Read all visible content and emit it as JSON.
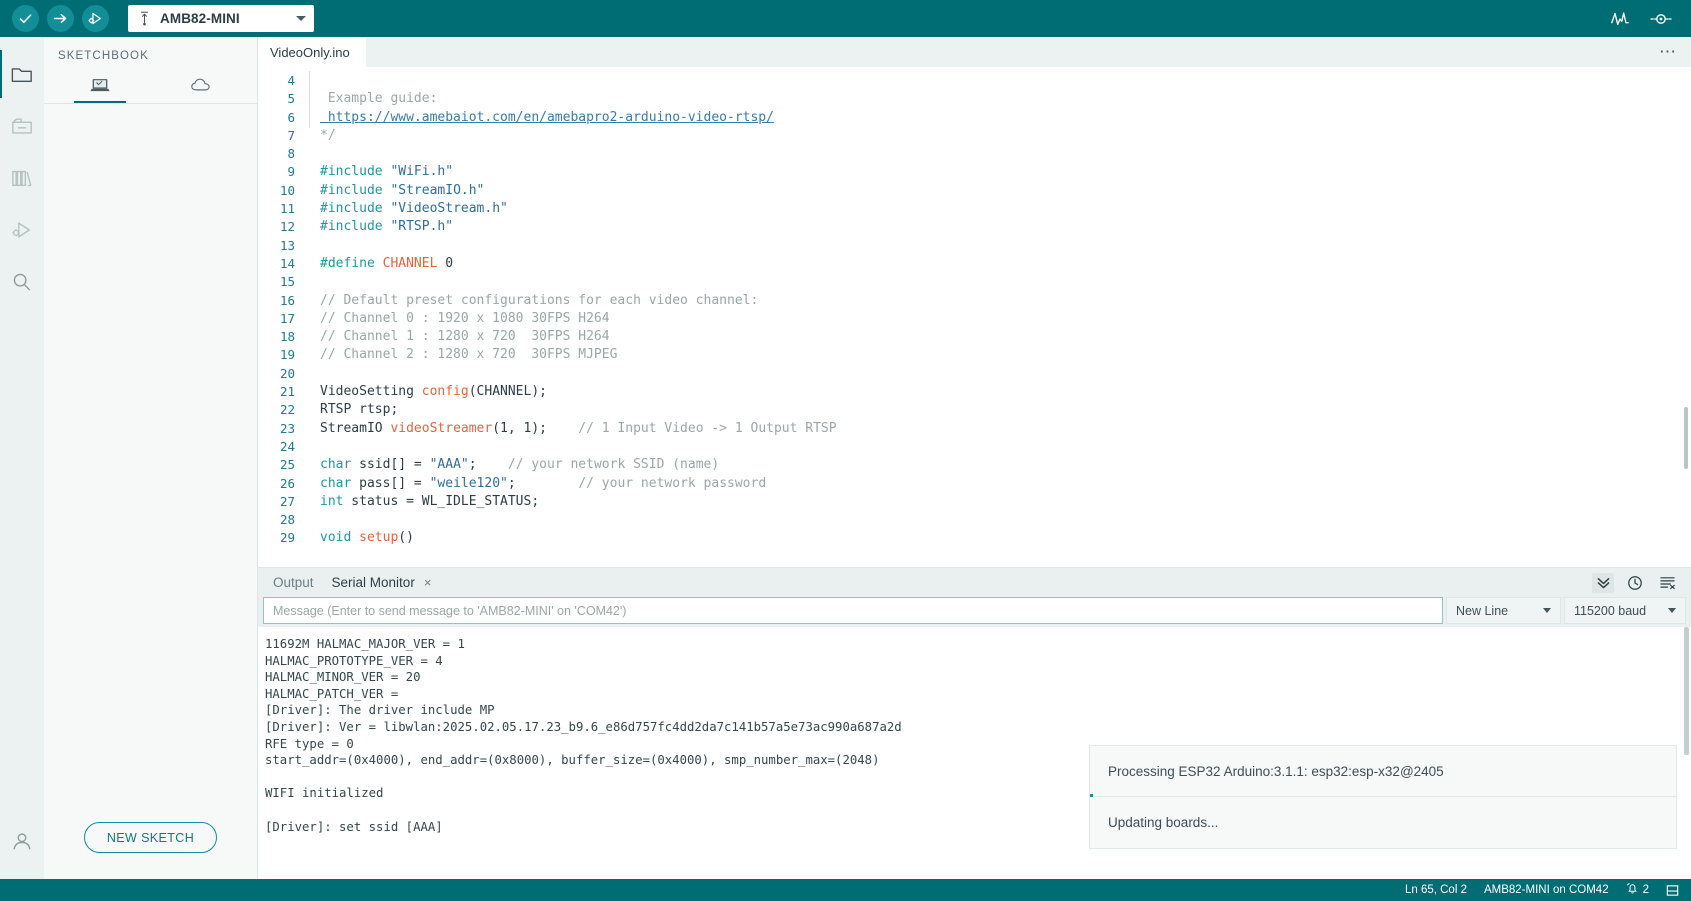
{
  "toolbar": {
    "verify_label": "verify-sketch",
    "upload_label": "upload-sketch",
    "debug_label": "start-debugging",
    "board_name": "AMB82-MINI",
    "serial_plotter_label": "serial-plotter",
    "serial_monitor_label": "serial-monitor"
  },
  "activitybar": {
    "items": [
      {
        "name": "sketchbook",
        "label": "Sketchbook"
      },
      {
        "name": "boards-manager",
        "label": "Boards Manager"
      },
      {
        "name": "library-manager",
        "label": "Library Manager"
      },
      {
        "name": "debug",
        "label": "Debug"
      },
      {
        "name": "search",
        "label": "Search"
      },
      {
        "name": "account",
        "label": "Account"
      }
    ]
  },
  "sidepanel": {
    "title": "SKETCHBOOK",
    "tabs": [
      {
        "label": "local",
        "icon": "laptop-icon",
        "active": true
      },
      {
        "label": "cloud",
        "icon": "cloud-icon",
        "active": false
      }
    ],
    "new_sketch_label": "NEW SKETCH"
  },
  "editor": {
    "tab_label": "VideoOnly.ino",
    "overflow_label": "…",
    "lines": [
      {
        "n": "4",
        "gutter": "cmt",
        "tokens": []
      },
      {
        "n": "5",
        "gutter": "cmt",
        "tokens": [
          {
            "t": "cmt",
            "s": " Example guide:"
          }
        ]
      },
      {
        "n": "6",
        "gutter": "cmt",
        "tokens": [
          {
            "t": "lnk",
            "s": " https://www.amebaiot.com/en/amebapro2-arduino-video-rtsp/"
          }
        ]
      },
      {
        "n": "7",
        "gutter": "",
        "tokens": [
          {
            "t": "cmt",
            "s": "*/"
          }
        ]
      },
      {
        "n": "8",
        "gutter": "",
        "tokens": []
      },
      {
        "n": "9",
        "gutter": "",
        "tokens": [
          {
            "t": "pre",
            "s": "#include "
          },
          {
            "t": "str",
            "s": "\"WiFi.h\""
          }
        ]
      },
      {
        "n": "10",
        "gutter": "",
        "tokens": [
          {
            "t": "pre",
            "s": "#include "
          },
          {
            "t": "str",
            "s": "\"StreamIO.h\""
          }
        ]
      },
      {
        "n": "11",
        "gutter": "",
        "tokens": [
          {
            "t": "pre",
            "s": "#include "
          },
          {
            "t": "str",
            "s": "\"VideoStream.h\""
          }
        ]
      },
      {
        "n": "12",
        "gutter": "",
        "tokens": [
          {
            "t": "pre",
            "s": "#include "
          },
          {
            "t": "str",
            "s": "\"RTSP.h\""
          }
        ]
      },
      {
        "n": "13",
        "gutter": "",
        "tokens": []
      },
      {
        "n": "14",
        "gutter": "",
        "tokens": [
          {
            "t": "pre",
            "s": "#define "
          },
          {
            "t": "fn",
            "s": "CHANNEL"
          },
          {
            "t": "pl",
            "s": " 0"
          }
        ]
      },
      {
        "n": "15",
        "gutter": "",
        "tokens": []
      },
      {
        "n": "16",
        "gutter": "",
        "tokens": [
          {
            "t": "cmt",
            "s": "// Default preset configurations for each video channel:"
          }
        ]
      },
      {
        "n": "17",
        "gutter": "",
        "tokens": [
          {
            "t": "cmt",
            "s": "// Channel 0 : 1920 x 1080 30FPS H264"
          }
        ]
      },
      {
        "n": "18",
        "gutter": "",
        "tokens": [
          {
            "t": "cmt",
            "s": "// Channel 1 : 1280 x 720  30FPS H264"
          }
        ]
      },
      {
        "n": "19",
        "gutter": "",
        "tokens": [
          {
            "t": "cmt",
            "s": "// Channel 2 : 1280 x 720  30FPS MJPEG"
          }
        ]
      },
      {
        "n": "20",
        "gutter": "",
        "tokens": []
      },
      {
        "n": "21",
        "gutter": "",
        "tokens": [
          {
            "t": "pl",
            "s": "VideoSetting "
          },
          {
            "t": "fn",
            "s": "config"
          },
          {
            "t": "pl",
            "s": "(CHANNEL);"
          }
        ]
      },
      {
        "n": "22",
        "gutter": "",
        "tokens": [
          {
            "t": "pl",
            "s": "RTSP rtsp;"
          }
        ]
      },
      {
        "n": "23",
        "gutter": "",
        "tokens": [
          {
            "t": "pl",
            "s": "StreamIO "
          },
          {
            "t": "fn",
            "s": "videoStreamer"
          },
          {
            "t": "pl",
            "s": "(1, 1);"
          },
          {
            "t": "cmt",
            "s": "    // 1 Input Video -> 1 Output RTSP"
          }
        ]
      },
      {
        "n": "24",
        "gutter": "",
        "tokens": []
      },
      {
        "n": "25",
        "gutter": "",
        "tokens": [
          {
            "t": "kw",
            "s": "char"
          },
          {
            "t": "pl",
            "s": " ssid[] = "
          },
          {
            "t": "str",
            "s": "\"AAA\""
          },
          {
            "t": "pl",
            "s": ";"
          },
          {
            "t": "cmt",
            "s": "    // your network SSID (name)"
          }
        ]
      },
      {
        "n": "26",
        "gutter": "",
        "tokens": [
          {
            "t": "kw",
            "s": "char"
          },
          {
            "t": "pl",
            "s": " pass[] = "
          },
          {
            "t": "str",
            "s": "\"weile120\""
          },
          {
            "t": "pl",
            "s": ";"
          },
          {
            "t": "cmt",
            "s": "        // your network password"
          }
        ]
      },
      {
        "n": "27",
        "gutter": "",
        "tokens": [
          {
            "t": "kw",
            "s": "int"
          },
          {
            "t": "pl",
            "s": " status = WL_IDLE_STATUS;"
          }
        ]
      },
      {
        "n": "28",
        "gutter": "",
        "tokens": []
      },
      {
        "n": "29",
        "gutter": "",
        "tokens": [
          {
            "t": "kw",
            "s": "void"
          },
          {
            "t": "pl",
            "s": " "
          },
          {
            "t": "fn",
            "s": "setup"
          },
          {
            "t": "pl",
            "s": "()"
          }
        ]
      }
    ]
  },
  "panel": {
    "tabs": [
      {
        "label": "Output",
        "active": false,
        "closable": false
      },
      {
        "label": "Serial Monitor",
        "active": true,
        "closable": true,
        "close_label": "×"
      }
    ],
    "tools": [
      {
        "name": "autoscroll-icon",
        "active": true
      },
      {
        "name": "timestamp-icon",
        "active": false
      },
      {
        "name": "clear-output-icon",
        "active": false
      }
    ],
    "message_placeholder": "Message (Enter to send message to 'AMB82-MINI' on 'COM42')",
    "message_value": "",
    "line_ending": "New Line",
    "baud_rate": "115200 baud",
    "output_lines": [
      "11692M HALMAC_MAJOR_VER = 1",
      "HALMAC_PROTOTYPE_VER = 4",
      "HALMAC_MINOR_VER = 20",
      "HALMAC_PATCH_VER = ",
      "[Driver]: The driver include MP",
      "[Driver]: Ver = libwlan:2025.02.05.17.23_b9.6_e86d757fc4dd2da7c141b57a5e73ac990a687a2d",
      "RFE type = 0",
      "start_addr=(0x4000), end_addr=(0x8000), buffer_size=(0x4000), smp_number_max=(2048)",
      "",
      "WIFI initialized",
      "",
      "[Driver]: set ssid [AAA]"
    ]
  },
  "toasts": [
    {
      "message": "Processing ESP32 Arduino:3.1.1: esp32:esp-x32@2405",
      "progress": true
    },
    {
      "message": "Updating boards...",
      "progress": false
    }
  ],
  "statusbar": {
    "cursor": "Ln 65, Col 2",
    "board": "AMB82-MINI on COM42",
    "notification_count": "2",
    "toggle_panel_label": "toggle-bottom-panel"
  },
  "colors": {
    "brand_teal": "#006d75",
    "accent_teal": "#128e96",
    "panel_bg": "#eaf0f0",
    "sidebar_bg": "#f7f9f9"
  }
}
